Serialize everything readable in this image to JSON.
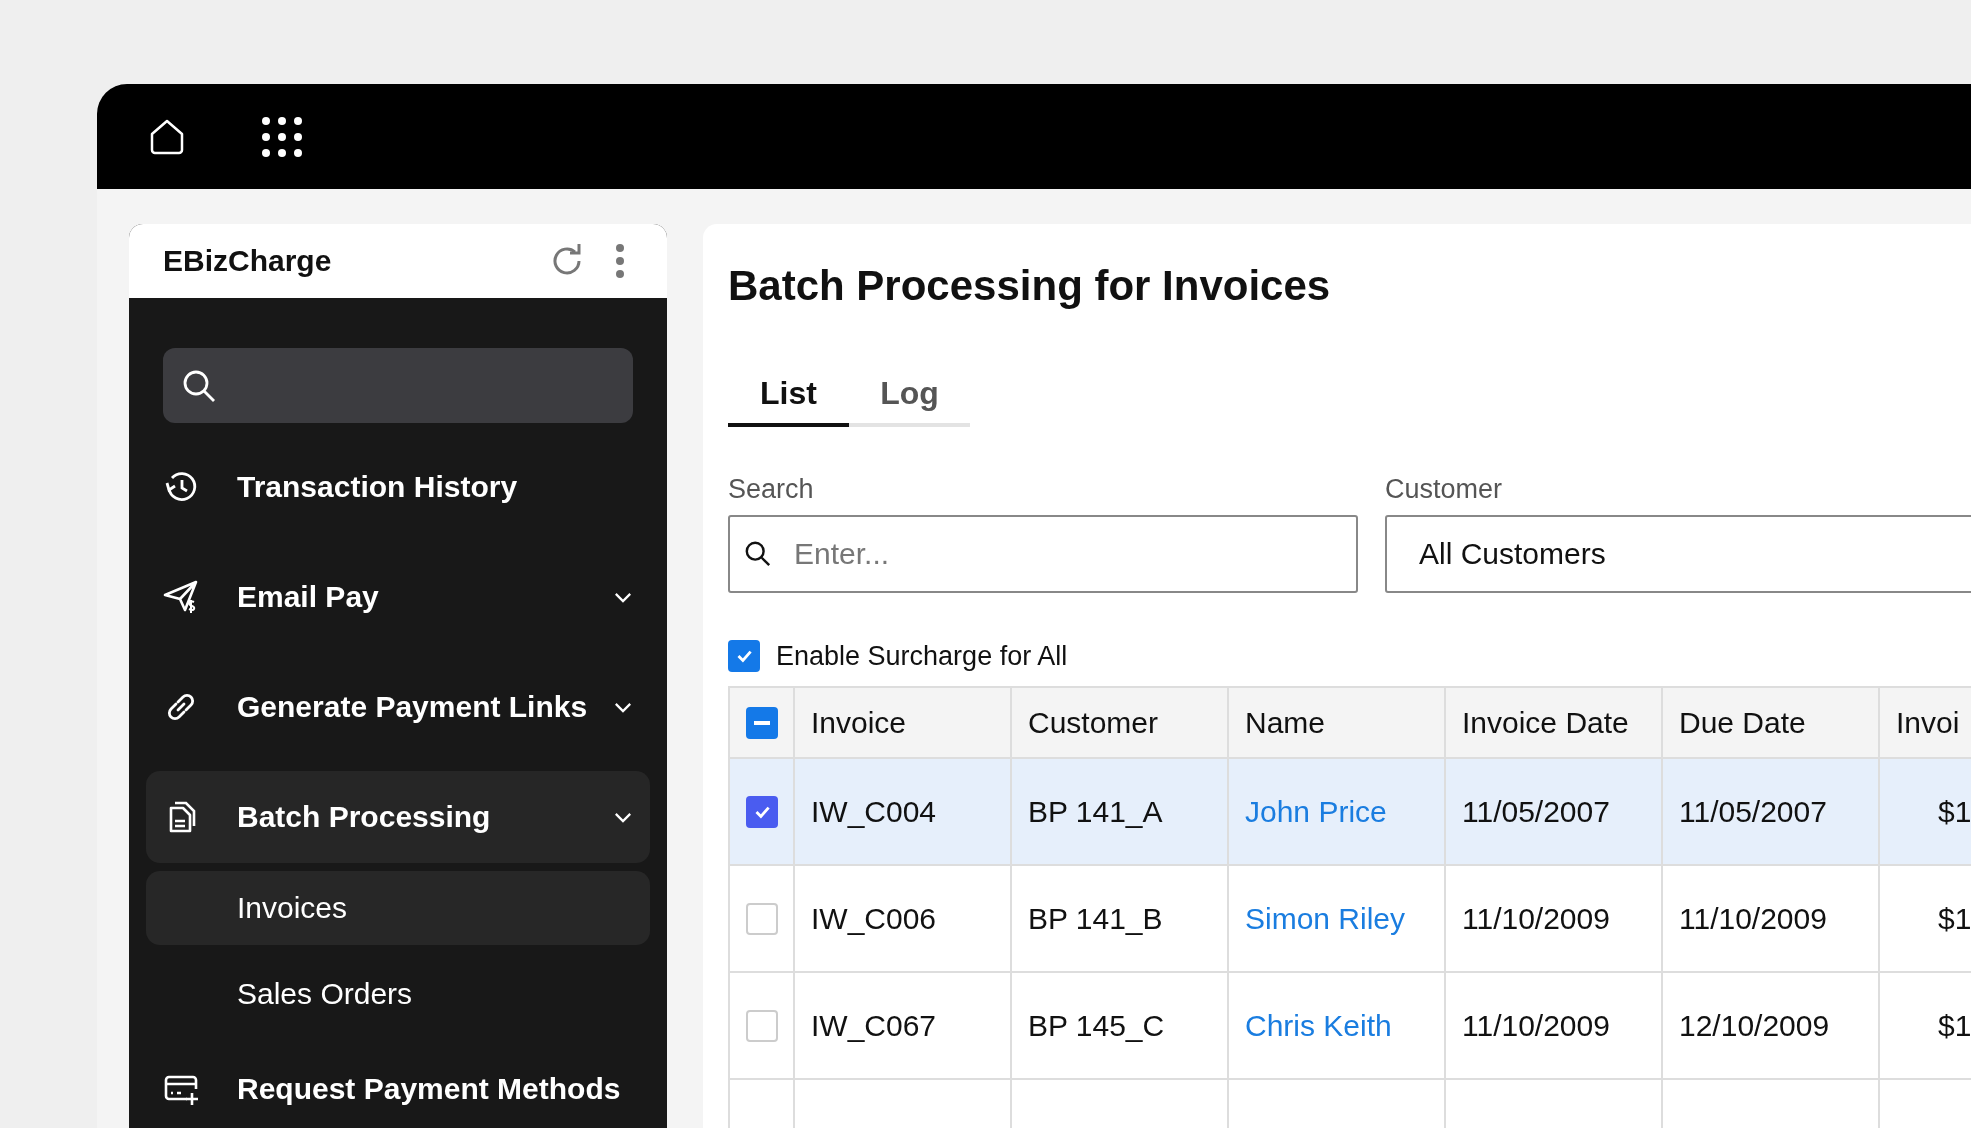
{
  "sidebar": {
    "app_name": "EBizCharge",
    "items": [
      {
        "label": "Transaction History",
        "kind": "link",
        "expanded": false
      },
      {
        "label": "Email Pay",
        "kind": "group",
        "expanded": false
      },
      {
        "label": "Generate Payment Links",
        "kind": "group",
        "expanded": false
      },
      {
        "label": "Batch Processing",
        "kind": "group",
        "expanded": true,
        "children": [
          {
            "label": "Invoices",
            "selected": true
          },
          {
            "label": "Sales Orders",
            "selected": false
          }
        ]
      },
      {
        "label": "Request Payment Methods",
        "kind": "link",
        "expanded": false
      }
    ]
  },
  "main": {
    "title": "Batch Processing for Invoices",
    "tabs": [
      {
        "label": "List",
        "selected": true
      },
      {
        "label": "Log",
        "selected": false
      }
    ],
    "search": {
      "label": "Search",
      "placeholder": "Enter..."
    },
    "customer": {
      "label": "Customer",
      "value": "All Customers"
    },
    "surcharge": {
      "label": "Enable Surcharge for All",
      "checked": true
    },
    "table": {
      "select_all": {
        "indeterminate": true
      },
      "columns": [
        "Invoice",
        "Customer",
        "Name",
        "Invoice Date",
        "Due Date",
        "Invoi"
      ],
      "rows": [
        {
          "selected": true,
          "invoice": "IW_C004",
          "customer": "BP 141_A",
          "name": "John Price",
          "invoice_date": "11/05/2007",
          "due_date": "11/05/2007",
          "column_7": "$1"
        },
        {
          "selected": false,
          "invoice": "IW_C006",
          "customer": "BP 141_B",
          "name": "Simon Riley",
          "invoice_date": "11/10/2009",
          "due_date": "11/10/2009",
          "column_7": "$1"
        },
        {
          "selected": false,
          "invoice": "IW_C067",
          "customer": "BP 145_C",
          "name": "Chris Keith",
          "invoice_date": "11/10/2009",
          "due_date": "12/10/2009",
          "column_7": "$1"
        }
      ]
    }
  }
}
